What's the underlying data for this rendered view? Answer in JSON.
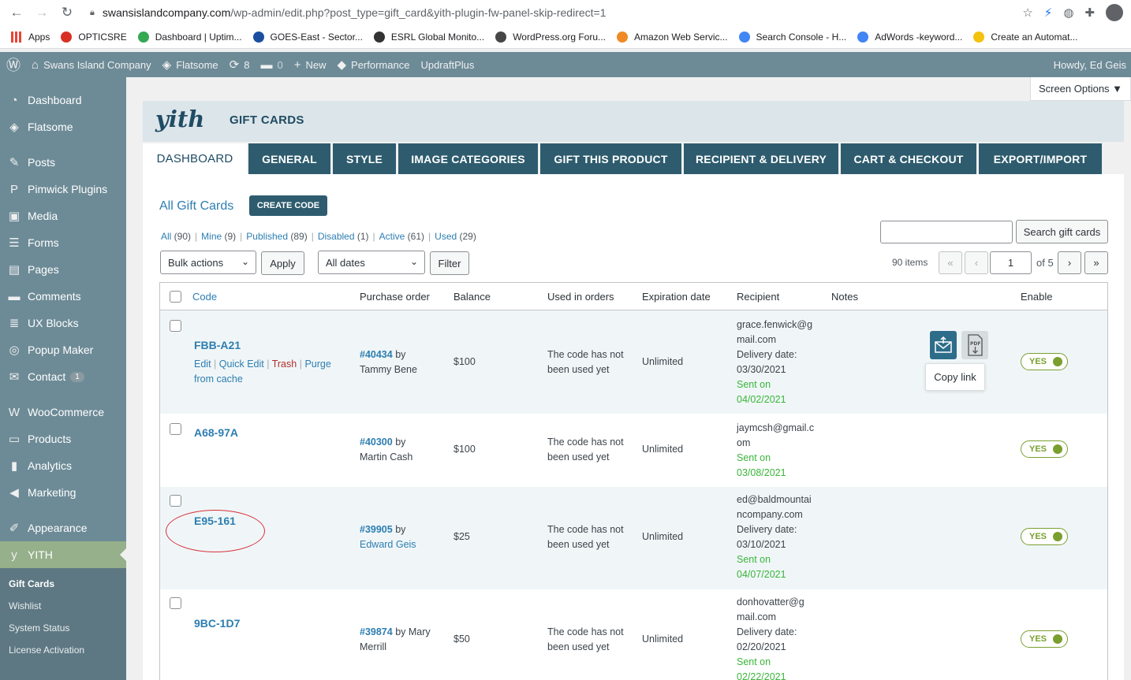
{
  "browser": {
    "url_host": "swansislandcompany.com",
    "url_path": "/wp-admin/edit.php?post_type=gift_card&yith-plugin-fw-panel-skip-redirect=1",
    "bookmarks": [
      {
        "label": "Apps",
        "color": "#ea4335"
      },
      {
        "label": "OPTICSRE",
        "color": "#d93025"
      },
      {
        "label": "Dashboard | Uptim...",
        "color": "#34a853"
      },
      {
        "label": "GOES-East - Sector...",
        "color": "#1a4fa0"
      },
      {
        "label": "ESRL Global Monito...",
        "color": "#333333"
      },
      {
        "label": "WordPress.org Foru...",
        "color": "#464646"
      },
      {
        "label": "Amazon Web Servic...",
        "color": "#f08a24"
      },
      {
        "label": "Search Console - H...",
        "color": "#4285f4"
      },
      {
        "label": "AdWords -keyword...",
        "color": "#4285f4"
      },
      {
        "label": "Create an Automat...",
        "color": "#f4c20d"
      }
    ]
  },
  "adminbar": {
    "site_name": "Swans Island Company",
    "theme": "Flatsome",
    "updates": "8",
    "comments": "0",
    "new_label": "New",
    "performance": "Performance",
    "updraft": "UpdraftPlus",
    "howdy": "Howdy, Ed Geis"
  },
  "sidebar": {
    "items": [
      {
        "label": "Dashboard",
        "icon": "dashboard-icon",
        "glyph": "◔"
      },
      {
        "label": "Flatsome",
        "icon": "flatsome-icon",
        "glyph": "◈"
      },
      {
        "label": "Posts",
        "icon": "pin-icon",
        "glyph": "✎"
      },
      {
        "label": "Pimwick Plugins",
        "icon": "pimwick-icon",
        "glyph": "P"
      },
      {
        "label": "Media",
        "icon": "media-icon",
        "glyph": "▣"
      },
      {
        "label": "Forms",
        "icon": "forms-icon",
        "glyph": "☰"
      },
      {
        "label": "Pages",
        "icon": "pages-icon",
        "glyph": "▤"
      },
      {
        "label": "Comments",
        "icon": "comments-icon",
        "glyph": "▬"
      },
      {
        "label": "UX Blocks",
        "icon": "blocks-icon",
        "glyph": "≣"
      },
      {
        "label": "Popup Maker",
        "icon": "popup-icon",
        "glyph": "◎"
      },
      {
        "label": "Contact",
        "icon": "mail-icon",
        "glyph": "✉",
        "badge": "1"
      },
      {
        "label": "WooCommerce",
        "icon": "woo-icon",
        "glyph": "W"
      },
      {
        "label": "Products",
        "icon": "archive-icon",
        "glyph": "▭"
      },
      {
        "label": "Analytics",
        "icon": "chart-icon",
        "glyph": "▮"
      },
      {
        "label": "Marketing",
        "icon": "megaphone-icon",
        "glyph": "◀"
      },
      {
        "label": "Appearance",
        "icon": "brush-icon",
        "glyph": "✐"
      },
      {
        "label": "YITH",
        "icon": "yith-icon",
        "glyph": "y"
      }
    ],
    "submenu": [
      "Gift Cards",
      "Wishlist",
      "System Status",
      "License Activation"
    ]
  },
  "screen_options": "Screen Options ▼",
  "header": {
    "logo": "yith",
    "title": "GIFT CARDS"
  },
  "tabs": [
    "DASHBOARD",
    "GENERAL",
    "STYLE",
    "IMAGE CATEGORIES",
    "GIFT THIS PRODUCT",
    "RECIPIENT & DELIVERY",
    "CART & CHECKOUT",
    "EXPORT/IMPORT"
  ],
  "page": {
    "title": "All Gift Cards",
    "create_button": "CREATE CODE"
  },
  "filters": [
    {
      "label": "All",
      "count": "(90)"
    },
    {
      "label": "Mine",
      "count": "(9)"
    },
    {
      "label": "Published",
      "count": "(89)"
    },
    {
      "label": "Disabled",
      "count": "(1)"
    },
    {
      "label": "Active",
      "count": "(61)"
    },
    {
      "label": "Used",
      "count": "(29)"
    }
  ],
  "search": {
    "button": "Search gift cards",
    "value": ""
  },
  "bulk": {
    "select": "Bulk actions",
    "apply": "Apply",
    "dates": "All dates",
    "filter": "Filter"
  },
  "pagination": {
    "items": "90 items",
    "first": "«",
    "prev": "‹",
    "current": "1",
    "of": "of 5",
    "next": "›",
    "last": "»"
  },
  "columns": [
    "Code",
    "Purchase order",
    "Balance",
    "Used in orders",
    "Expiration date",
    "Recipient",
    "Notes",
    "Enable"
  ],
  "row_actions": {
    "edit": "Edit",
    "quick_edit": "Quick Edit",
    "trash": "Trash",
    "purge": "Purge",
    "from_cache": "from cache"
  },
  "rows": [
    {
      "code": "FBB-A21",
      "order": "#40434",
      "by": "by",
      "buyer": "Tammy Bene",
      "balance": "$100",
      "used1": "The code has not",
      "used2": "been used yet",
      "expiration": "Unlimited",
      "rec1": "grace.fenwick@g",
      "rec2": "mail.com",
      "delivery_label": "Delivery date:",
      "delivery_date": "03/30/2021",
      "sent_label": "Sent on",
      "sent_date": "04/02/2021",
      "enable": "YES"
    },
    {
      "code": "A68-97A",
      "order": "#40300",
      "by": "by",
      "buyer": "Martin Cash",
      "balance": "$100",
      "used1": "The code has not",
      "used2": "been used yet",
      "expiration": "Unlimited",
      "rec1": "jaymcsh@gmail.c",
      "rec2": "om",
      "sent_label": "Sent on",
      "sent_date": "03/08/2021",
      "enable": "YES"
    },
    {
      "code": "E95-161",
      "order": "#39905",
      "by": "by",
      "buyer": "Edward Geis",
      "balance": "$25",
      "used1": "The code has not",
      "used2": "been used yet",
      "expiration": "Unlimited",
      "rec1": "ed@baldmountai",
      "rec2": "ncompany.com",
      "delivery_label": "Delivery date:",
      "delivery_date": "03/10/2021",
      "sent_label": "Sent on",
      "sent_date": "04/07/2021",
      "enable": "YES"
    },
    {
      "code": "9BC-1D7",
      "order": "#39874",
      "by": "by Mary",
      "buyer": "Merrill",
      "balance": "$50",
      "used1": "The code has not",
      "used2": "been used yet",
      "expiration": "Unlimited",
      "rec1": "donhovatter@g",
      "rec2": "mail.com",
      "delivery_label": "Delivery date:",
      "delivery_date": "02/20/2021",
      "sent_label": "Sent on",
      "sent_date": "02/22/2021",
      "enable": "YES"
    }
  ],
  "tooltip": "Copy link",
  "pdf_label": "PDF"
}
